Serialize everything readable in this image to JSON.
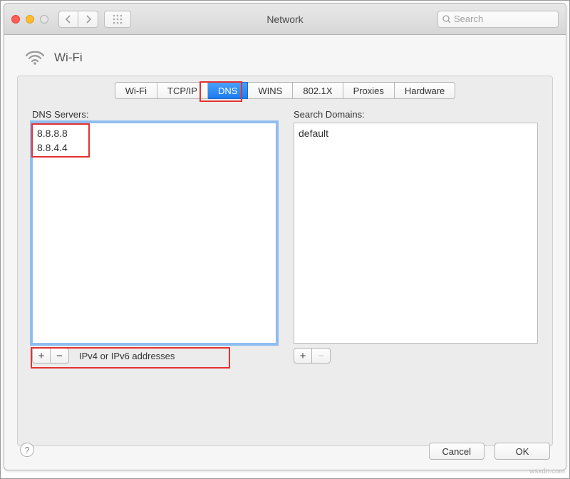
{
  "window": {
    "title": "Network"
  },
  "search": {
    "placeholder": "Search"
  },
  "header": {
    "title": "Wi-Fi"
  },
  "tabs": [
    {
      "label": "Wi-Fi",
      "active": false
    },
    {
      "label": "TCP/IP",
      "active": false
    },
    {
      "label": "DNS",
      "active": true
    },
    {
      "label": "WINS",
      "active": false
    },
    {
      "label": "802.1X",
      "active": false
    },
    {
      "label": "Proxies",
      "active": false
    },
    {
      "label": "Hardware",
      "active": false
    }
  ],
  "dns": {
    "label": "DNS Servers:",
    "items": [
      "8.8.8.8",
      "8.8.4.4"
    ],
    "add_remove_hint": "IPv4 or IPv6 addresses"
  },
  "domains": {
    "label": "Search Domains:",
    "items": [
      "default"
    ]
  },
  "buttons": {
    "cancel": "Cancel",
    "ok": "OK",
    "plus": "+",
    "minus": "−"
  },
  "watermark": "wsxdn.com"
}
